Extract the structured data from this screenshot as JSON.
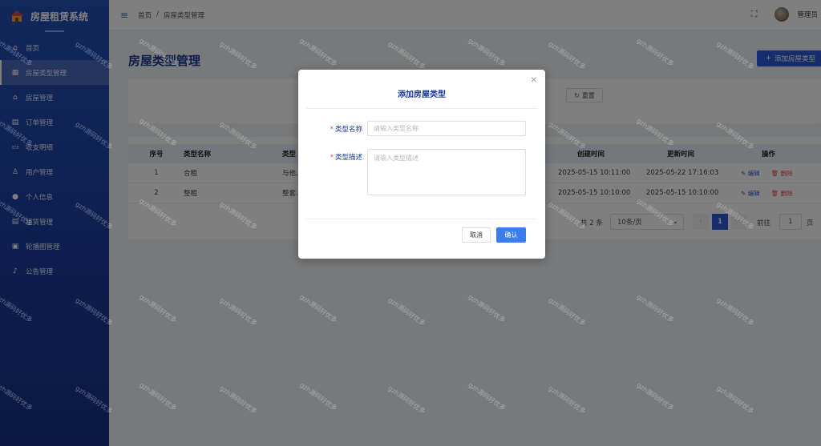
{
  "app": {
    "title": "房屋租赁系统"
  },
  "sidebar": {
    "items": [
      {
        "label": "首页",
        "icon": "home-icon"
      },
      {
        "label": "房屋类型管理",
        "icon": "grid-icon",
        "active": true
      },
      {
        "label": "房屋管理",
        "icon": "house-icon"
      },
      {
        "label": "订单管理",
        "icon": "document-icon"
      },
      {
        "label": "收支明细",
        "icon": "ledger-icon"
      },
      {
        "label": "用户管理",
        "icon": "user-icon"
      },
      {
        "label": "个人信息",
        "icon": "person-icon"
      },
      {
        "label": "租赁管理",
        "icon": "file-icon"
      },
      {
        "label": "轮播图管理",
        "icon": "image-icon"
      },
      {
        "label": "公告管理",
        "icon": "bell-icon"
      }
    ]
  },
  "header": {
    "breadcrumb": [
      "首页",
      "/",
      "房屋类型管理"
    ],
    "user_name": "管理员"
  },
  "main": {
    "page_title": "房屋类型管理",
    "add_button": "添加房屋类型",
    "reset_button": "重置",
    "table": {
      "columns": [
        "序号",
        "类型名称",
        "类型",
        "创建时间",
        "更新时间",
        "操作"
      ],
      "rows": [
        {
          "idx": "1",
          "name": "合租",
          "desc": "与他...",
          "created": "2025-05-15 10:11:00",
          "updated": "2025-05-22 17:16:03",
          "edit": "编辑",
          "del": "删除"
        },
        {
          "idx": "2",
          "name": "整租",
          "desc": "整套...",
          "created": "2025-05-15 10:10:00",
          "updated": "2025-05-15 10:10:00",
          "edit": "编辑",
          "del": "删除"
        }
      ]
    },
    "pager": {
      "total": "共 2 条",
      "page_size": "10条/页",
      "current": "1",
      "goto_label": "前往",
      "goto_value": "1",
      "page_suffix": "页"
    }
  },
  "dialog": {
    "title": "添加房屋类型",
    "name_label": "类型名称",
    "name_placeholder": "请输入类型名称",
    "desc_label": "类型描述",
    "desc_placeholder": "请输入类型描述",
    "cancel": "取消",
    "confirm": "确认"
  },
  "watermark": "gzh源码好优多",
  "colors": {
    "primary": "#2b5bd7",
    "sidebar": "#1a3c9c",
    "danger": "#e04848"
  }
}
